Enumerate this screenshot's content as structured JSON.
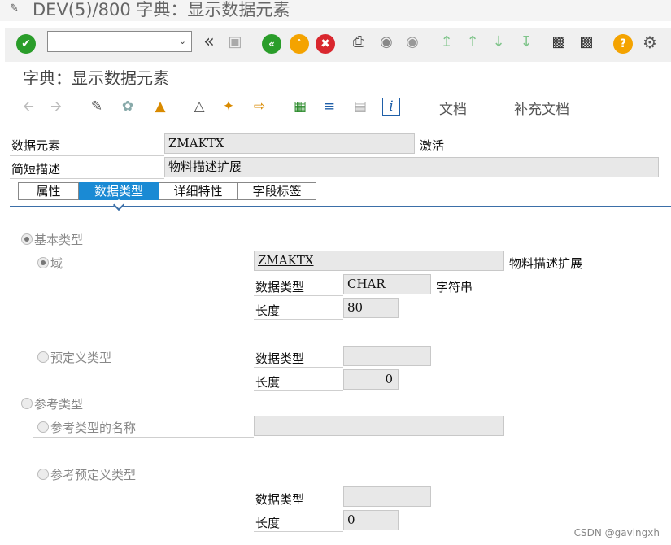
{
  "window": {
    "title": "DEV(5)/800 字典：显示数据元素"
  },
  "toolbar": {
    "command_value": "",
    "colors": {
      "enter": "#2a9d2a",
      "back": "#2a9d2a",
      "exit": "#f4a300",
      "cancel": "#d9272e",
      "help": "#f4a300"
    },
    "icons": [
      "enter-icon",
      "chevron-left-double-icon",
      "save-icon",
      "back-icon",
      "exit-icon",
      "cancel-icon",
      "print-icon",
      "find-icon",
      "find-next-icon",
      "first-page-icon",
      "previous-page-icon",
      "next-page-icon",
      "last-page-icon",
      "create-session-icon",
      "shortcut-icon",
      "help-icon",
      "settings-icon"
    ]
  },
  "screen": {
    "title": "字典：显示数据元素"
  },
  "app_toolbar": {
    "icons": [
      "back-arrow-icon",
      "forward-arrow-icon",
      "display-change-icon",
      "other-object-icon",
      "activate-icon",
      "where-used-icon",
      "object-list-icon",
      "navigate-icon",
      "hierarchy-icon",
      "tree-icon",
      "table-icon",
      "info-icon"
    ],
    "documentation": "文档",
    "supplementary_documentation": "补充文档"
  },
  "header": {
    "data_element_label": "数据元素",
    "data_element_value": "ZMAKTX",
    "status": "激活",
    "short_desc_label": "简短描述",
    "short_desc_value": "物料描述扩展"
  },
  "tabs": [
    {
      "label": "属性",
      "active": false
    },
    {
      "label": "数据类型",
      "active": true
    },
    {
      "label": "详细特性",
      "active": false
    },
    {
      "label": "字段标签",
      "active": false
    }
  ],
  "data_type": {
    "elementary_label": "基本类型",
    "domain_label": "域",
    "domain_value": "ZMAKTX",
    "domain_desc": "物料描述扩展",
    "data_type_label": "数据类型",
    "data_type_value": "CHAR",
    "data_type_desc": "字符串",
    "length_label": "长度",
    "length_value": "80",
    "predefined_label": "预定义类型",
    "pre_data_type_label": "数据类型",
    "pre_data_type_value": "",
    "pre_length_label": "长度",
    "pre_length_value": "0",
    "reference_label": "参考类型",
    "ref_name_label": "参考类型的名称",
    "ref_name_value": "",
    "ref_predefined_label": "参考预定义类型",
    "ref_data_type_label": "数据类型",
    "ref_data_type_value": "",
    "ref_length_label": "长度",
    "ref_length_value": "0"
  },
  "watermark": "CSDN @gavingxh"
}
